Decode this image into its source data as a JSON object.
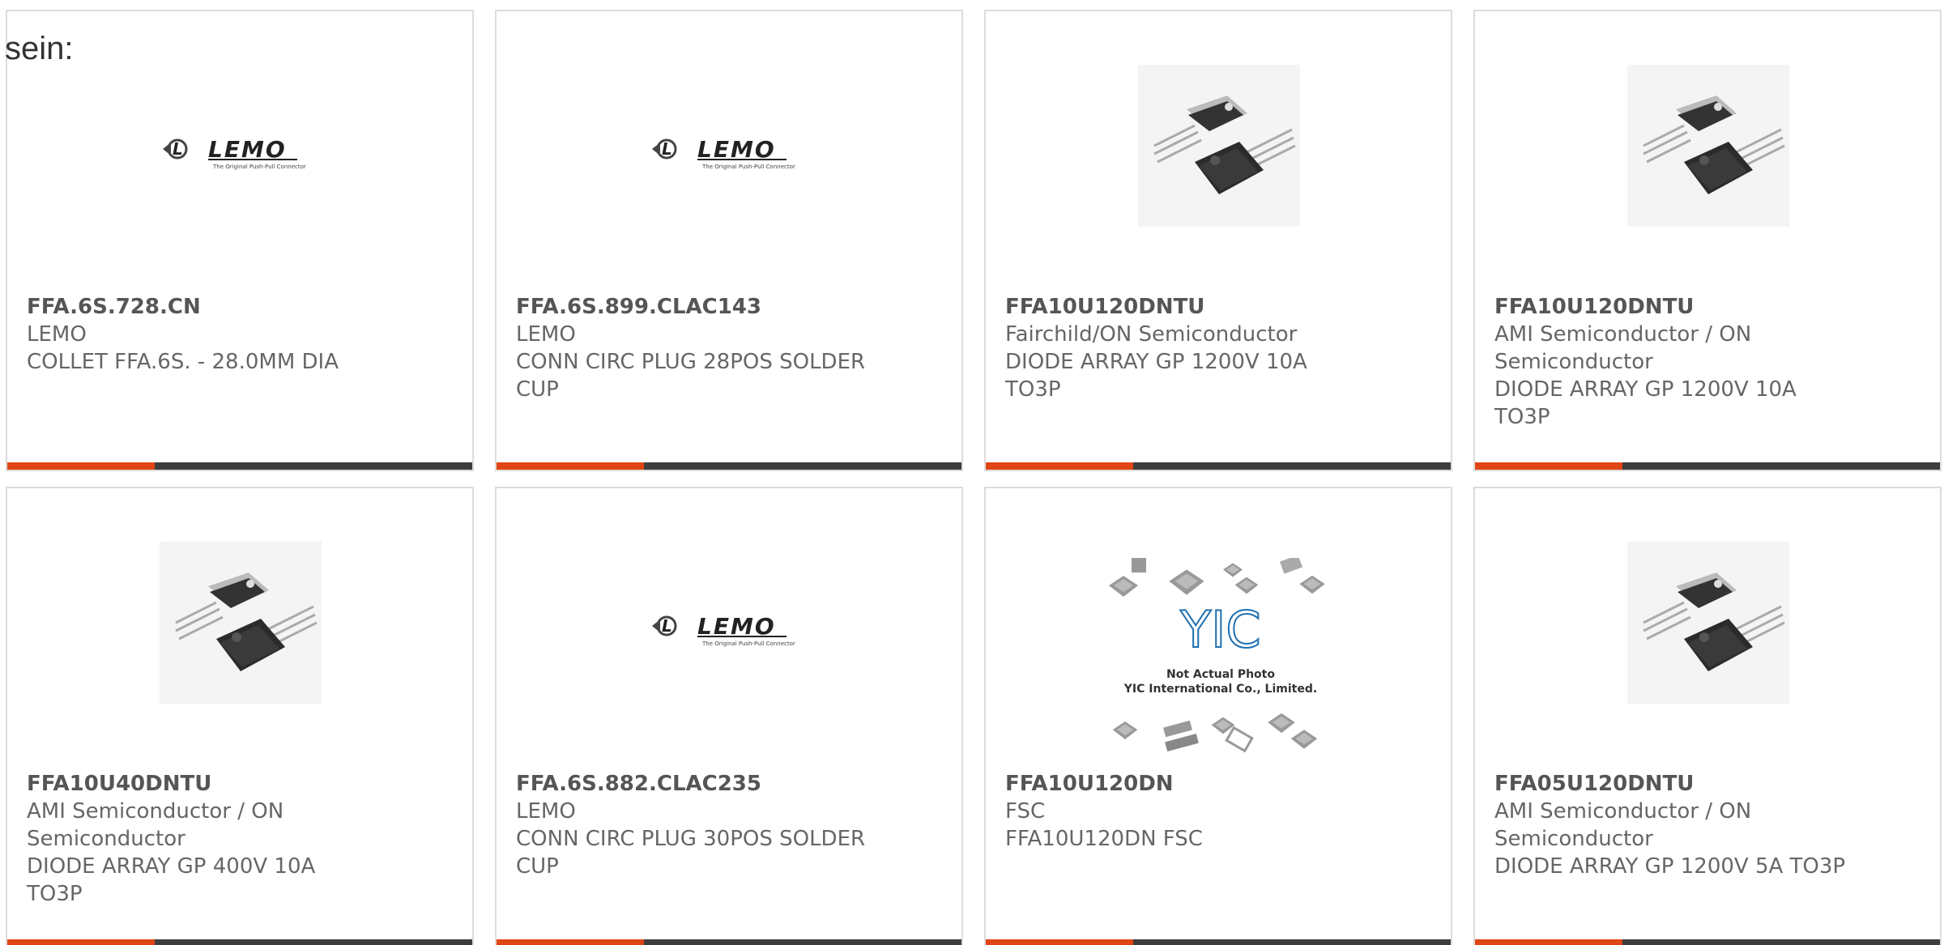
{
  "intro_text": "sein:",
  "colors": {
    "accent": "#e04515",
    "bar": "#3d3d3d",
    "border": "#dcdcdc",
    "text": "#666666"
  },
  "cards": [
    {
      "part": "FFA.6S.728.CN",
      "manufacturer": "LEMO",
      "description": "COLLET FFA.6S. - 28.0MM DIA",
      "image": "lemo-logo"
    },
    {
      "part": "FFA.6S.899.CLAC143",
      "manufacturer": "LEMO",
      "description": "CONN CIRC PLUG 28POS SOLDER CUP",
      "image": "lemo-logo"
    },
    {
      "part": "FFA10U120DNTU",
      "manufacturer": "Fairchild/ON Semiconductor",
      "description": "DIODE ARRAY GP 1200V 10A TO3P",
      "image": "to3p-package"
    },
    {
      "part": "FFA10U120DNTU",
      "manufacturer": "AMI Semiconductor / ON Semiconductor",
      "description": "DIODE ARRAY GP 1200V 10A TO3P",
      "image": "to3p-package"
    },
    {
      "part": "FFA10U40DNTU",
      "manufacturer": "AMI Semiconductor / ON Semiconductor",
      "description": "DIODE ARRAY GP 400V 10A TO3P",
      "image": "to3p-package"
    },
    {
      "part": "FFA.6S.882.CLAC235",
      "manufacturer": "LEMO",
      "description": "CONN CIRC PLUG 30POS SOLDER CUP",
      "image": "lemo-logo"
    },
    {
      "part": "FFA10U120DN",
      "manufacturer": "FSC",
      "description": "FFA10U120DN FSC",
      "image": "yic-placeholder"
    },
    {
      "part": "FFA05U120DNTU",
      "manufacturer": "AMI Semiconductor / ON Semiconductor",
      "description": "DIODE ARRAY GP 1200V 5A TO3P",
      "image": "to3p-package"
    }
  ],
  "images": {
    "lemo_logo_text": "LEMO",
    "lemo_tagline": "The Original Push-Pull Connector",
    "yic_logo_text": "YIC",
    "yic_line1": "Not Actual Photo",
    "yic_line2": "YIC International Co., Limited."
  }
}
